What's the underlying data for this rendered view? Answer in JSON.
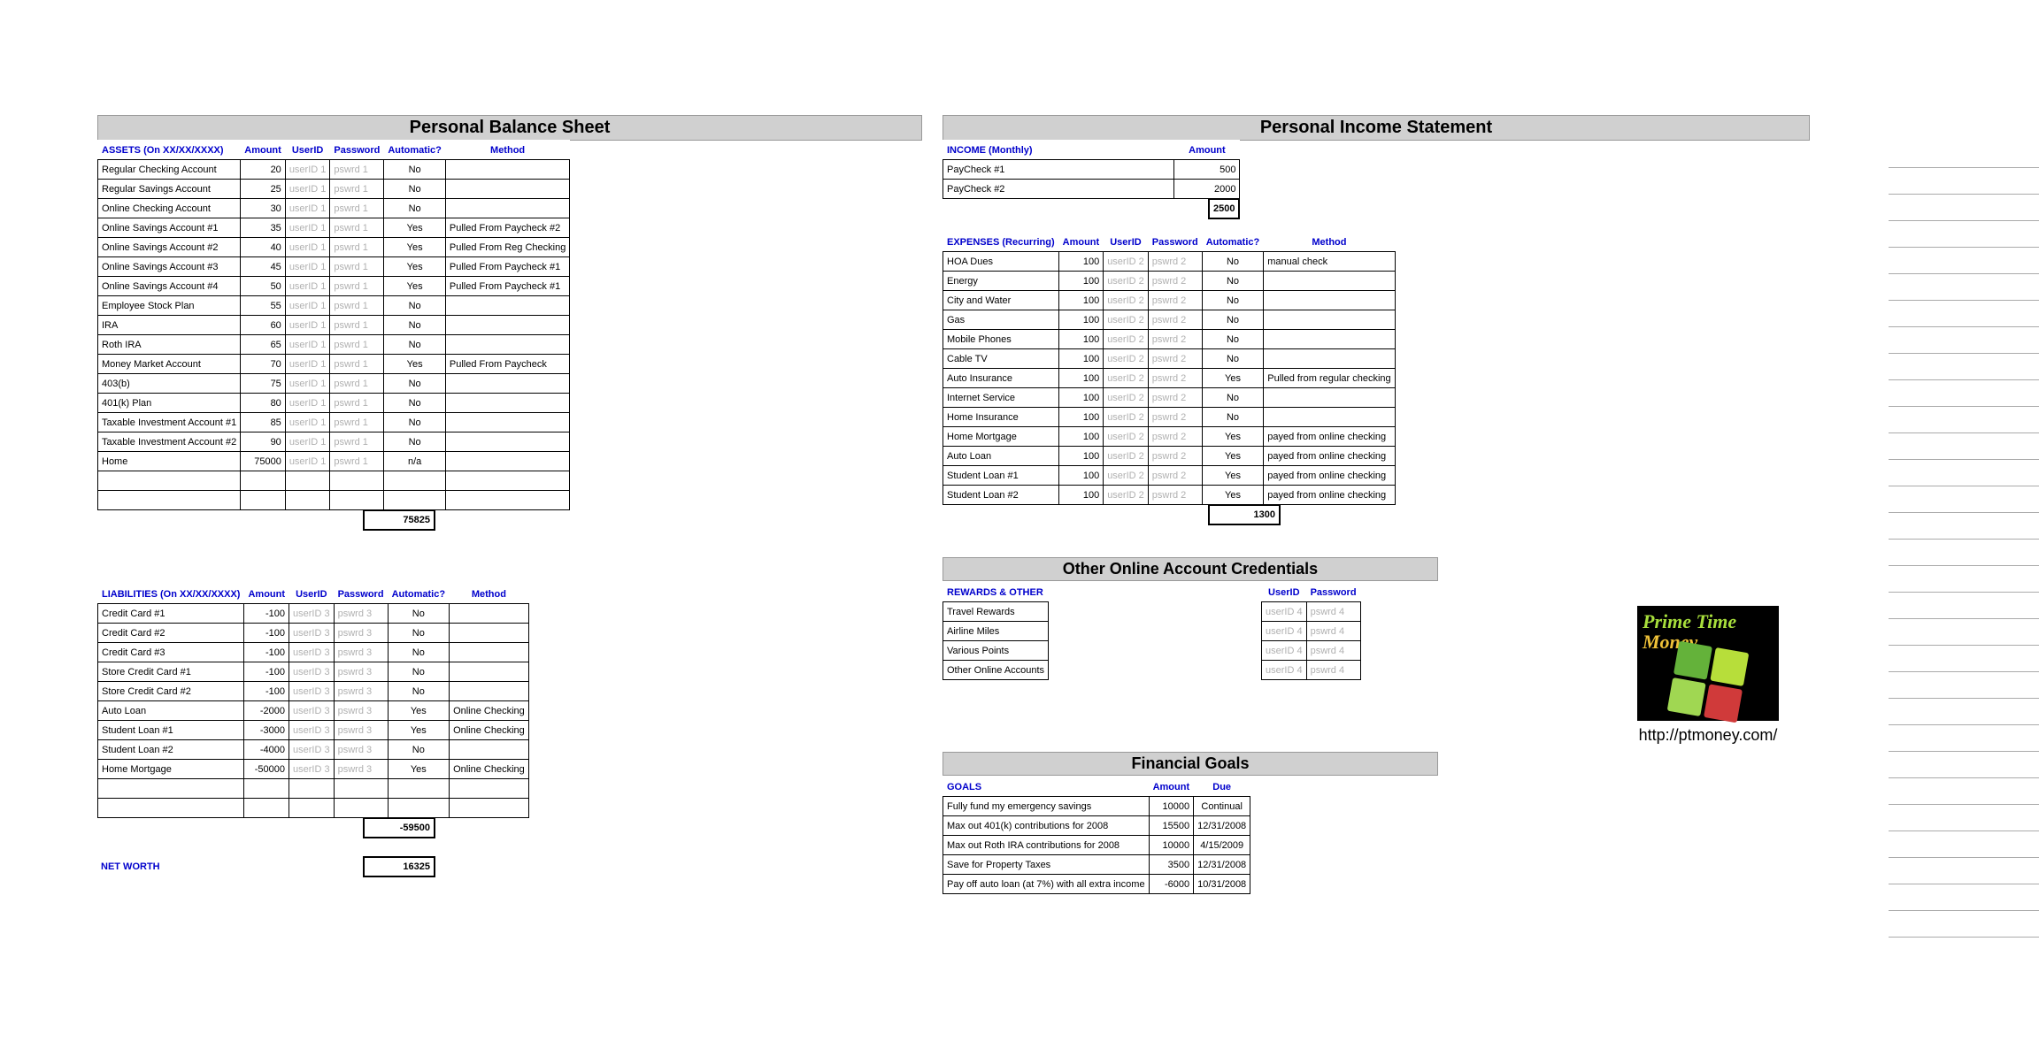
{
  "balance": {
    "title": "Personal Balance Sheet",
    "assets_header": "ASSETS (On XX/XX/XXXX)",
    "liab_header": "LIABILITIES (On XX/XX/XXXX)",
    "cols": {
      "amount": "Amount",
      "userid": "UserID",
      "password": "Password",
      "auto": "Automatic?",
      "method": "Method"
    },
    "assets": [
      {
        "name": "Regular Checking Account",
        "amt": "20",
        "uid": "userID 1",
        "pwd": "pswrd 1",
        "auto": "No",
        "method": ""
      },
      {
        "name": "Regular Savings Account",
        "amt": "25",
        "uid": "userID 1",
        "pwd": "pswrd 1",
        "auto": "No",
        "method": ""
      },
      {
        "name": "Online Checking Account",
        "amt": "30",
        "uid": "userID 1",
        "pwd": "pswrd 1",
        "auto": "No",
        "method": ""
      },
      {
        "name": "Online Savings Account #1",
        "amt": "35",
        "uid": "userID 1",
        "pwd": "pswrd 1",
        "auto": "Yes",
        "method": "Pulled From Paycheck #2"
      },
      {
        "name": "Online Savings Account #2",
        "amt": "40",
        "uid": "userID 1",
        "pwd": "pswrd 1",
        "auto": "Yes",
        "method": "Pulled From Reg Checking"
      },
      {
        "name": "Online Savings Account #3",
        "amt": "45",
        "uid": "userID 1",
        "pwd": "pswrd 1",
        "auto": "Yes",
        "method": "Pulled From Paycheck #1"
      },
      {
        "name": "Online Savings Account #4",
        "amt": "50",
        "uid": "userID 1",
        "pwd": "pswrd 1",
        "auto": "Yes",
        "method": "Pulled From Paycheck #1"
      },
      {
        "name": "Employee Stock Plan",
        "amt": "55",
        "uid": "userID 1",
        "pwd": "pswrd 1",
        "auto": "No",
        "method": ""
      },
      {
        "name": "IRA",
        "amt": "60",
        "uid": "userID 1",
        "pwd": "pswrd 1",
        "auto": "No",
        "method": ""
      },
      {
        "name": "Roth IRA",
        "amt": "65",
        "uid": "userID 1",
        "pwd": "pswrd 1",
        "auto": "No",
        "method": ""
      },
      {
        "name": "Money Market Account",
        "amt": "70",
        "uid": "userID 1",
        "pwd": "pswrd 1",
        "auto": "Yes",
        "method": "Pulled From Paycheck"
      },
      {
        "name": "403(b)",
        "amt": "75",
        "uid": "userID 1",
        "pwd": "pswrd 1",
        "auto": "No",
        "method": ""
      },
      {
        "name": "401(k) Plan",
        "amt": "80",
        "uid": "userID 1",
        "pwd": "pswrd 1",
        "auto": "No",
        "method": ""
      },
      {
        "name": "Taxable Investment Account #1",
        "amt": "85",
        "uid": "userID 1",
        "pwd": "pswrd 1",
        "auto": "No",
        "method": ""
      },
      {
        "name": "Taxable Investment Account #2",
        "amt": "90",
        "uid": "userID 1",
        "pwd": "pswrd 1",
        "auto": "No",
        "method": ""
      },
      {
        "name": "Home",
        "amt": "75000",
        "uid": "userID 1",
        "pwd": "pswrd 1",
        "auto": "n/a",
        "method": ""
      }
    ],
    "assets_total": "75825",
    "liabilities": [
      {
        "name": "Credit Card #1",
        "amt": "-100",
        "uid": "userID 3",
        "pwd": "pswrd 3",
        "auto": "No",
        "method": ""
      },
      {
        "name": "Credit Card #2",
        "amt": "-100",
        "uid": "userID 3",
        "pwd": "pswrd 3",
        "auto": "No",
        "method": ""
      },
      {
        "name": "Credit Card #3",
        "amt": "-100",
        "uid": "userID 3",
        "pwd": "pswrd 3",
        "auto": "No",
        "method": ""
      },
      {
        "name": "Store Credit Card #1",
        "amt": "-100",
        "uid": "userID 3",
        "pwd": "pswrd 3",
        "auto": "No",
        "method": ""
      },
      {
        "name": "Store Credit Card #2",
        "amt": "-100",
        "uid": "userID 3",
        "pwd": "pswrd 3",
        "auto": "No",
        "method": ""
      },
      {
        "name": "Auto Loan",
        "amt": "-2000",
        "uid": "userID 3",
        "pwd": "pswrd 3",
        "auto": "Yes",
        "method": "Online Checking"
      },
      {
        "name": "Student Loan #1",
        "amt": "-3000",
        "uid": "userID 3",
        "pwd": "pswrd 3",
        "auto": "Yes",
        "method": "Online Checking"
      },
      {
        "name": "Student Loan #2",
        "amt": "-4000",
        "uid": "userID 3",
        "pwd": "pswrd 3",
        "auto": "No",
        "method": ""
      },
      {
        "name": "Home Mortgage",
        "amt": "-50000",
        "uid": "userID 3",
        "pwd": "pswrd 3",
        "auto": "Yes",
        "method": "Online Checking"
      }
    ],
    "liab_total": "-59500",
    "net_worth_label": "NET WORTH",
    "net_worth": "16325"
  },
  "income": {
    "title": "Personal Income Statement",
    "income_header": "INCOME (Monthly)",
    "amount_header": "Amount",
    "rows": [
      {
        "name": "PayCheck #1",
        "amt": "500"
      },
      {
        "name": "PayCheck #2",
        "amt": "2000"
      }
    ],
    "income_total": "2500",
    "expenses_header": "EXPENSES (Recurring)",
    "cols": {
      "amount": "Amount",
      "userid": "UserID",
      "password": "Password",
      "auto": "Automatic?",
      "method": "Method"
    },
    "expenses": [
      {
        "name": "HOA Dues",
        "amt": "100",
        "uid": "userID 2",
        "pwd": "pswrd 2",
        "auto": "No",
        "method": "manual check"
      },
      {
        "name": "Energy",
        "amt": "100",
        "uid": "userID 2",
        "pwd": "pswrd 2",
        "auto": "No",
        "method": ""
      },
      {
        "name": "City and Water",
        "amt": "100",
        "uid": "userID 2",
        "pwd": "pswrd 2",
        "auto": "No",
        "method": ""
      },
      {
        "name": "Gas",
        "amt": "100",
        "uid": "userID 2",
        "pwd": "pswrd 2",
        "auto": "No",
        "method": ""
      },
      {
        "name": "Mobile Phones",
        "amt": "100",
        "uid": "userID 2",
        "pwd": "pswrd 2",
        "auto": "No",
        "method": ""
      },
      {
        "name": "Cable TV",
        "amt": "100",
        "uid": "userID 2",
        "pwd": "pswrd 2",
        "auto": "No",
        "method": ""
      },
      {
        "name": "Auto Insurance",
        "amt": "100",
        "uid": "userID 2",
        "pwd": "pswrd 2",
        "auto": "Yes",
        "method": "Pulled from regular checking"
      },
      {
        "name": "Internet Service",
        "amt": "100",
        "uid": "userID 2",
        "pwd": "pswrd 2",
        "auto": "No",
        "method": ""
      },
      {
        "name": "Home Insurance",
        "amt": "100",
        "uid": "userID 2",
        "pwd": "pswrd 2",
        "auto": "No",
        "method": ""
      },
      {
        "name": "Home Mortgage",
        "amt": "100",
        "uid": "userID 2",
        "pwd": "pswrd 2",
        "auto": "Yes",
        "method": "payed from online checking"
      },
      {
        "name": "Auto Loan",
        "amt": "100",
        "uid": "userID 2",
        "pwd": "pswrd 2",
        "auto": "Yes",
        "method": "payed from online checking"
      },
      {
        "name": "Student Loan #1",
        "amt": "100",
        "uid": "userID 2",
        "pwd": "pswrd 2",
        "auto": "Yes",
        "method": "payed from online checking"
      },
      {
        "name": "Student Loan #2",
        "amt": "100",
        "uid": "userID 2",
        "pwd": "pswrd 2",
        "auto": "Yes",
        "method": "payed from online checking"
      }
    ],
    "expenses_total": "1300"
  },
  "other": {
    "title": "Other Online Account Credentials",
    "header": "REWARDS & OTHER",
    "userid_header": "UserID",
    "password_header": "Password",
    "rows": [
      {
        "name": "Travel Rewards",
        "uid": "userID 4",
        "pwd": "pswrd 4"
      },
      {
        "name": "Airline Miles",
        "uid": "userID 4",
        "pwd": "pswrd 4"
      },
      {
        "name": "Various Points",
        "uid": "userID 4",
        "pwd": "pswrd 4"
      },
      {
        "name": "Other Online Accounts",
        "uid": "userID 4",
        "pwd": "pswrd 4"
      }
    ]
  },
  "goals": {
    "title": "Financial Goals",
    "header": "GOALS",
    "amount_header": "Amount",
    "due_header": "Due",
    "rows": [
      {
        "name": "Fully fund my emergency savings",
        "amt": "10000",
        "due": "Continual"
      },
      {
        "name": "Max out 401(k) contributions for 2008",
        "amt": "15500",
        "due": "12/31/2008"
      },
      {
        "name": "Max out Roth IRA contributions for 2008",
        "amt": "10000",
        "due": "4/15/2009"
      },
      {
        "name": "Save for Property Taxes",
        "amt": "3500",
        "due": "12/31/2008"
      },
      {
        "name": "Pay off auto loan (at 7%) with all extra income",
        "amt": "-6000",
        "due": "10/31/2008"
      }
    ]
  },
  "branding": {
    "logo_line1": "Prime Time",
    "logo_line2": "Money",
    "url": "http://ptmoney.com/"
  }
}
